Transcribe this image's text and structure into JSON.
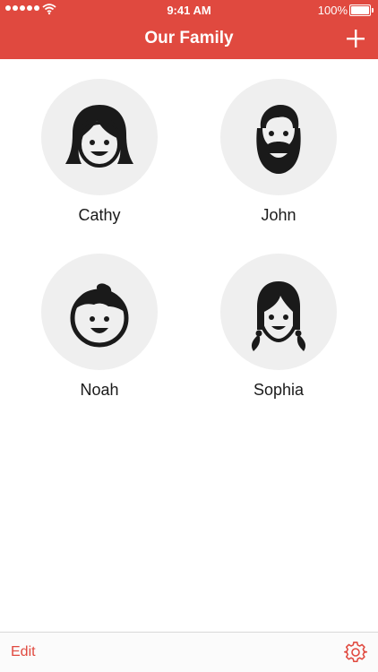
{
  "status_bar": {
    "time": "9:41 AM",
    "battery": "100%",
    "signal_icon": "signal-dots-icon",
    "wifi_icon": "wifi-icon",
    "battery_icon": "battery-icon"
  },
  "nav": {
    "title": "Our Family",
    "add_icon": "plus-icon"
  },
  "members": [
    {
      "name": "Cathy",
      "avatar": "woman-avatar-icon"
    },
    {
      "name": "John",
      "avatar": "bearded-man-avatar-icon"
    },
    {
      "name": "Noah",
      "avatar": "boy-avatar-icon"
    },
    {
      "name": "Sophia",
      "avatar": "girl-pigtails-avatar-icon"
    }
  ],
  "toolbar": {
    "edit_label": "Edit",
    "settings_icon": "gear-icon"
  },
  "colors": {
    "accent": "#e0493f",
    "avatar_bg": "#efefef",
    "icon": "#1a1a1a"
  }
}
